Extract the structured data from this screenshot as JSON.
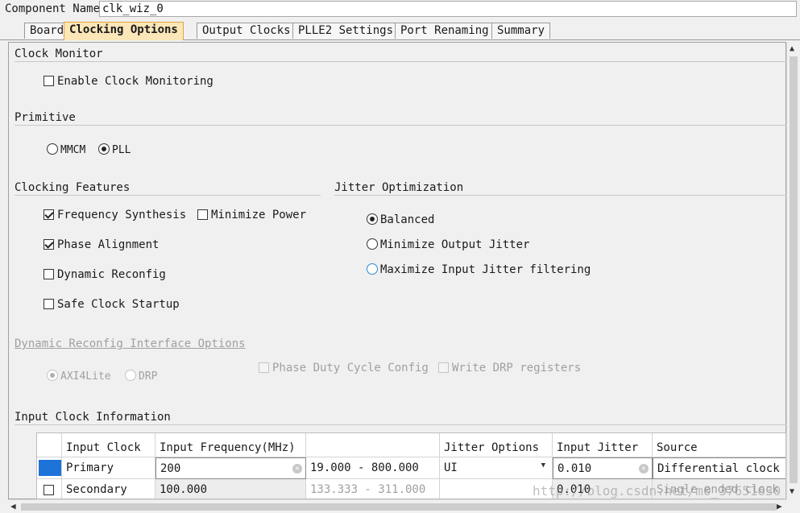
{
  "component": {
    "label": "Component Name",
    "value": "clk_wiz_0"
  },
  "tabs": [
    {
      "label": "Board"
    },
    {
      "label": "Clocking Options"
    },
    {
      "label": "Output Clocks"
    },
    {
      "label": "PLLE2 Settings"
    },
    {
      "label": "Port Renaming"
    },
    {
      "label": "Summary"
    }
  ],
  "active_tab": "Clocking Options",
  "clock_monitor": {
    "title": "Clock Monitor",
    "enable_label": "Enable Clock Monitoring",
    "enable_checked": false
  },
  "primitive": {
    "title": "Primitive",
    "options": [
      {
        "label": "MMCM",
        "selected": false
      },
      {
        "label": "PLL",
        "selected": true
      }
    ]
  },
  "clocking_features": {
    "title": "Clocking Features",
    "frequency_synthesis": {
      "label": "Frequency Synthesis",
      "checked": true
    },
    "minimize_power": {
      "label": "Minimize Power",
      "checked": false
    },
    "phase_alignment": {
      "label": "Phase Alignment",
      "checked": true
    },
    "dynamic_reconfig": {
      "label": "Dynamic Reconfig",
      "checked": false
    },
    "safe_clock_startup": {
      "label": "Safe Clock Startup",
      "checked": false
    }
  },
  "jitter_optimization": {
    "title": "Jitter Optimization",
    "options": [
      {
        "label": "Balanced",
        "selected": true
      },
      {
        "label": "Minimize Output Jitter",
        "selected": false
      },
      {
        "label": "Maximize Input Jitter filtering",
        "selected": false
      }
    ]
  },
  "drp": {
    "title": "Dynamic Reconfig Interface Options",
    "axi4lite": "AXI4Lite",
    "drp": "DRP",
    "phase_duty": "Phase Duty Cycle Config",
    "write_drp": "Write DRP registers"
  },
  "input_clock": {
    "title": "Input Clock Information",
    "headers": [
      "Input Clock",
      "Input Frequency(MHz)",
      "",
      "Jitter Options",
      "Input Jitter",
      "Source"
    ],
    "rows": [
      {
        "name": "Primary",
        "freq": "200",
        "range": "19.000 - 800.000",
        "jitter_opt": "UI",
        "jitter": "0.010",
        "source": "Differential clock capable pin"
      },
      {
        "name": "Secondary",
        "freq": "100.000",
        "range": "133.333 - 311.000",
        "jitter_opt": "",
        "jitter": "0.010",
        "source": "Single ended clock capable pin"
      }
    ]
  },
  "watermark": "http://blog.csdn.net/m0_37651630",
  "colors": {
    "active_tab_bg": "#fbe6b8",
    "active_tab_border": "#e4a43a",
    "selection": "#1e73d8",
    "focus_radio": "#2e86d6"
  }
}
